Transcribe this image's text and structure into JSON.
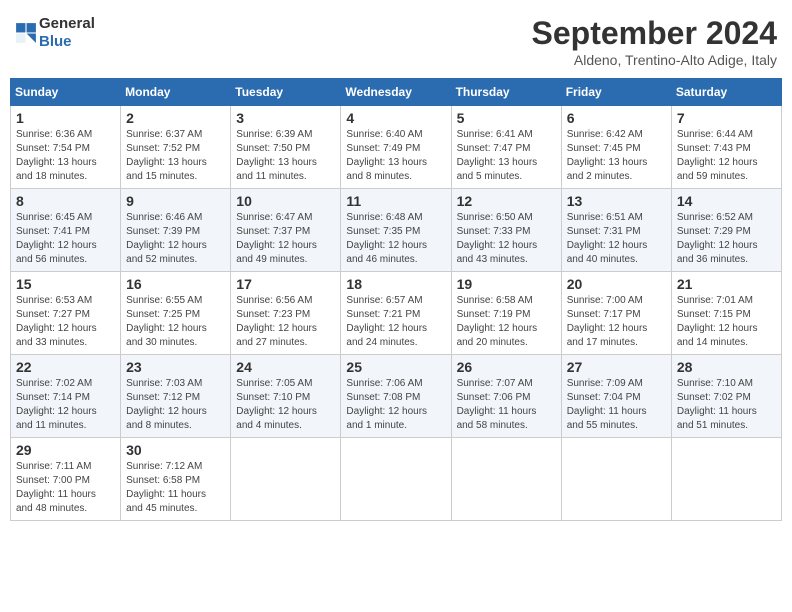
{
  "logo": {
    "line1": "General",
    "line2": "Blue"
  },
  "title": "September 2024",
  "location": "Aldeno, Trentino-Alto Adige, Italy",
  "headers": [
    "Sunday",
    "Monday",
    "Tuesday",
    "Wednesday",
    "Thursday",
    "Friday",
    "Saturday"
  ],
  "weeks": [
    [
      {
        "day": "1",
        "info": "Sunrise: 6:36 AM\nSunset: 7:54 PM\nDaylight: 13 hours\nand 18 minutes."
      },
      {
        "day": "2",
        "info": "Sunrise: 6:37 AM\nSunset: 7:52 PM\nDaylight: 13 hours\nand 15 minutes."
      },
      {
        "day": "3",
        "info": "Sunrise: 6:39 AM\nSunset: 7:50 PM\nDaylight: 13 hours\nand 11 minutes."
      },
      {
        "day": "4",
        "info": "Sunrise: 6:40 AM\nSunset: 7:49 PM\nDaylight: 13 hours\nand 8 minutes."
      },
      {
        "day": "5",
        "info": "Sunrise: 6:41 AM\nSunset: 7:47 PM\nDaylight: 13 hours\nand 5 minutes."
      },
      {
        "day": "6",
        "info": "Sunrise: 6:42 AM\nSunset: 7:45 PM\nDaylight: 13 hours\nand 2 minutes."
      },
      {
        "day": "7",
        "info": "Sunrise: 6:44 AM\nSunset: 7:43 PM\nDaylight: 12 hours\nand 59 minutes."
      }
    ],
    [
      {
        "day": "8",
        "info": "Sunrise: 6:45 AM\nSunset: 7:41 PM\nDaylight: 12 hours\nand 56 minutes."
      },
      {
        "day": "9",
        "info": "Sunrise: 6:46 AM\nSunset: 7:39 PM\nDaylight: 12 hours\nand 52 minutes."
      },
      {
        "day": "10",
        "info": "Sunrise: 6:47 AM\nSunset: 7:37 PM\nDaylight: 12 hours\nand 49 minutes."
      },
      {
        "day": "11",
        "info": "Sunrise: 6:48 AM\nSunset: 7:35 PM\nDaylight: 12 hours\nand 46 minutes."
      },
      {
        "day": "12",
        "info": "Sunrise: 6:50 AM\nSunset: 7:33 PM\nDaylight: 12 hours\nand 43 minutes."
      },
      {
        "day": "13",
        "info": "Sunrise: 6:51 AM\nSunset: 7:31 PM\nDaylight: 12 hours\nand 40 minutes."
      },
      {
        "day": "14",
        "info": "Sunrise: 6:52 AM\nSunset: 7:29 PM\nDaylight: 12 hours\nand 36 minutes."
      }
    ],
    [
      {
        "day": "15",
        "info": "Sunrise: 6:53 AM\nSunset: 7:27 PM\nDaylight: 12 hours\nand 33 minutes."
      },
      {
        "day": "16",
        "info": "Sunrise: 6:55 AM\nSunset: 7:25 PM\nDaylight: 12 hours\nand 30 minutes."
      },
      {
        "day": "17",
        "info": "Sunrise: 6:56 AM\nSunset: 7:23 PM\nDaylight: 12 hours\nand 27 minutes."
      },
      {
        "day": "18",
        "info": "Sunrise: 6:57 AM\nSunset: 7:21 PM\nDaylight: 12 hours\nand 24 minutes."
      },
      {
        "day": "19",
        "info": "Sunrise: 6:58 AM\nSunset: 7:19 PM\nDaylight: 12 hours\nand 20 minutes."
      },
      {
        "day": "20",
        "info": "Sunrise: 7:00 AM\nSunset: 7:17 PM\nDaylight: 12 hours\nand 17 minutes."
      },
      {
        "day": "21",
        "info": "Sunrise: 7:01 AM\nSunset: 7:15 PM\nDaylight: 12 hours\nand 14 minutes."
      }
    ],
    [
      {
        "day": "22",
        "info": "Sunrise: 7:02 AM\nSunset: 7:14 PM\nDaylight: 12 hours\nand 11 minutes."
      },
      {
        "day": "23",
        "info": "Sunrise: 7:03 AM\nSunset: 7:12 PM\nDaylight: 12 hours\nand 8 minutes."
      },
      {
        "day": "24",
        "info": "Sunrise: 7:05 AM\nSunset: 7:10 PM\nDaylight: 12 hours\nand 4 minutes."
      },
      {
        "day": "25",
        "info": "Sunrise: 7:06 AM\nSunset: 7:08 PM\nDaylight: 12 hours\nand 1 minute."
      },
      {
        "day": "26",
        "info": "Sunrise: 7:07 AM\nSunset: 7:06 PM\nDaylight: 11 hours\nand 58 minutes."
      },
      {
        "day": "27",
        "info": "Sunrise: 7:09 AM\nSunset: 7:04 PM\nDaylight: 11 hours\nand 55 minutes."
      },
      {
        "day": "28",
        "info": "Sunrise: 7:10 AM\nSunset: 7:02 PM\nDaylight: 11 hours\nand 51 minutes."
      }
    ],
    [
      {
        "day": "29",
        "info": "Sunrise: 7:11 AM\nSunset: 7:00 PM\nDaylight: 11 hours\nand 48 minutes."
      },
      {
        "day": "30",
        "info": "Sunrise: 7:12 AM\nSunset: 6:58 PM\nDaylight: 11 hours\nand 45 minutes."
      },
      {
        "day": "",
        "info": ""
      },
      {
        "day": "",
        "info": ""
      },
      {
        "day": "",
        "info": ""
      },
      {
        "day": "",
        "info": ""
      },
      {
        "day": "",
        "info": ""
      }
    ]
  ]
}
